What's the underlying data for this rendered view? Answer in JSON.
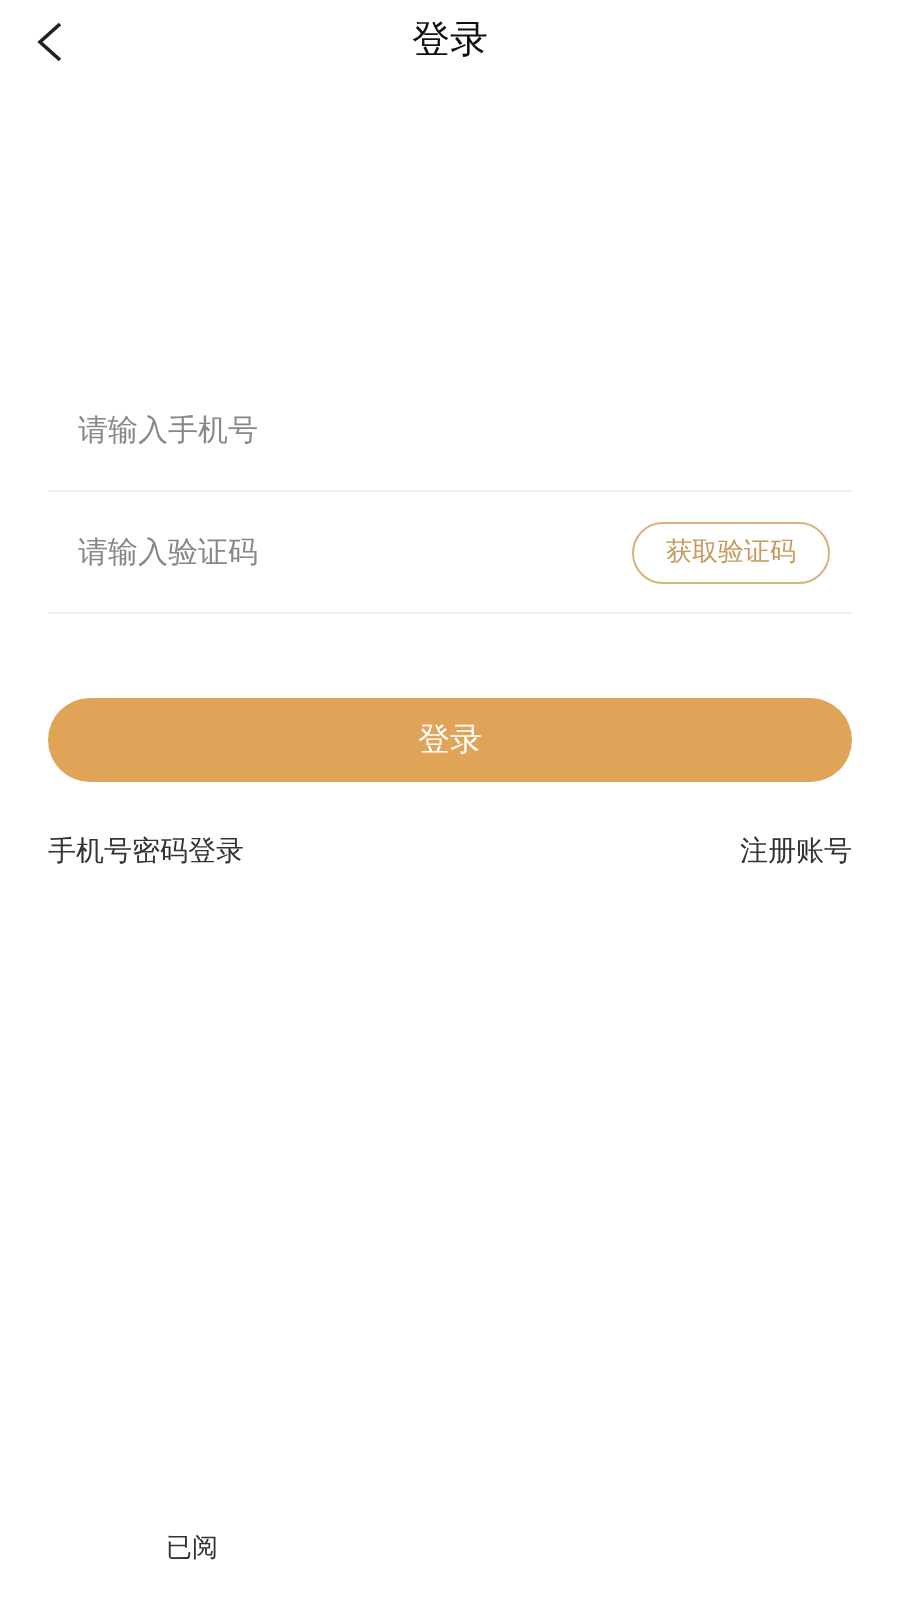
{
  "header": {
    "title": "登录"
  },
  "form": {
    "phone": {
      "placeholder": "请输入手机号"
    },
    "code": {
      "placeholder": "请输入验证码"
    },
    "get_code_button": "获取验证码",
    "login_button": "登录",
    "links": [
      "手机号密码登录",
      "注册账号"
    ]
  },
  "footer": {
    "agreement_text": "已阅"
  }
}
